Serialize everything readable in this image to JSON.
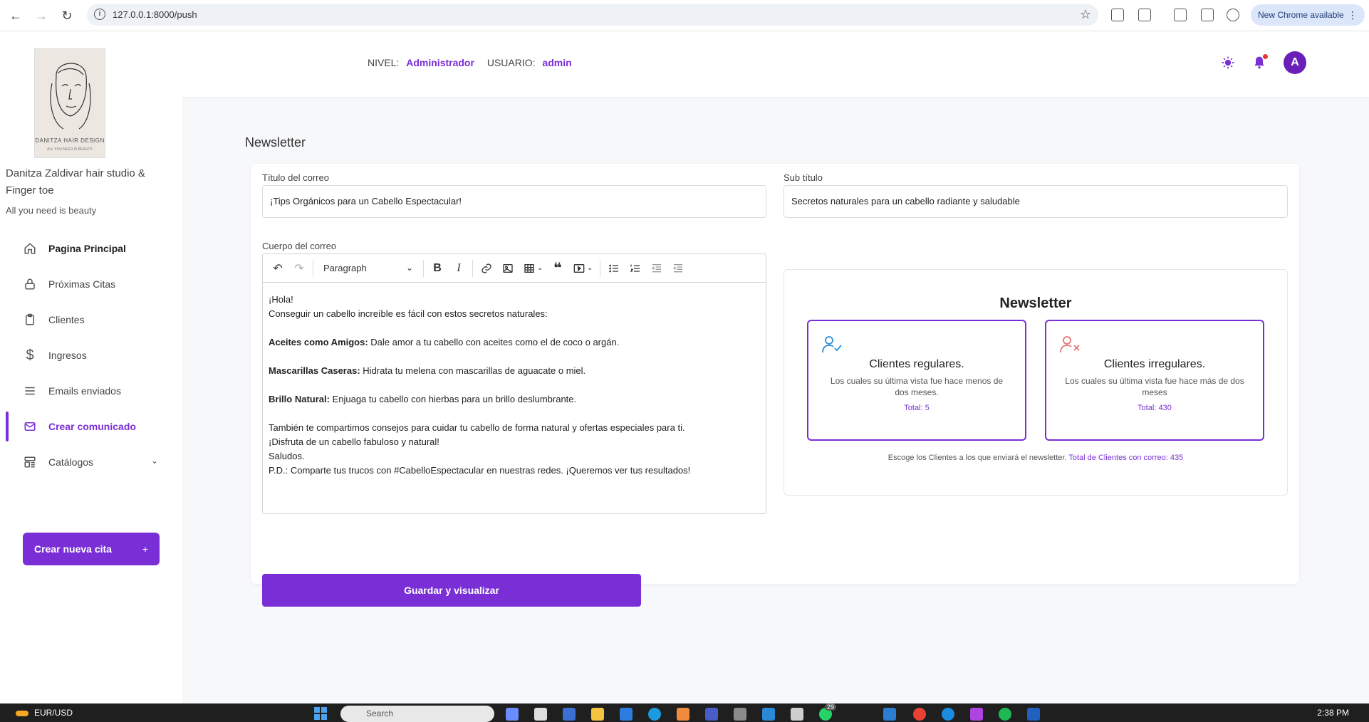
{
  "browser": {
    "url": "127.0.0.1:8000/push",
    "new_chrome_label": "New Chrome available"
  },
  "sidebar": {
    "logo_brand": "DANITZA HAIR DESIGN",
    "logo_tag": "ALL YOU NEED IS BEAUTY",
    "business_name": "Danitza Zaldivar hair studio & Finger toe",
    "slogan": "All you need is beauty",
    "items": [
      {
        "label": "Pagina Principal",
        "icon": "home-icon"
      },
      {
        "label": "Próximas Citas",
        "icon": "lock-icon"
      },
      {
        "label": "Clientes",
        "icon": "clipboard-icon"
      },
      {
        "label": "Ingresos",
        "icon": "dollar-icon"
      },
      {
        "label": "Emails enviados",
        "icon": "list-icon"
      },
      {
        "label": "Crear comunicado",
        "icon": "mail-icon"
      },
      {
        "label": "Catálogos",
        "icon": "catalog-icon"
      }
    ],
    "new_appointment_label": "Crear nueva cita",
    "new_appointment_plus": "+"
  },
  "header": {
    "level_label": "NIVEL:",
    "level_value": "Administrador",
    "user_label": "USUARIO:",
    "user_value": "admin",
    "avatar_letter": "A"
  },
  "page": {
    "title": "Newsletter"
  },
  "form": {
    "title_label": "Título del correo",
    "title_value": "¡Tips Orgánicos para un Cabello Espectacular!",
    "subtitle_label": "Sub título",
    "subtitle_value": "Secretos naturales para un cabello radiante y saludable",
    "body_label": "Cuerpo del correo",
    "paragraph_select": "Paragraph",
    "body": {
      "l1": "¡Hola!",
      "l2": "Conseguir un cabello increíble es fácil con estos secretos naturales:",
      "l3_bold": "Aceites como Amigos:",
      "l3_rest": " Dale amor a tu cabello con aceites como el de coco o argán.",
      "l4_bold": "Mascarillas Caseras:",
      "l4_rest": " Hidrata tu melena con mascarillas de aguacate o miel.",
      "l5_bold": "Brillo Natural:",
      "l5_rest": " Enjuaga tu cabello con hierbas para un brillo deslumbrante.",
      "l6": "También te compartimos consejos para cuidar tu cabello de forma natural y ofertas especiales para ti.",
      "l7": "¡Disfruta de un cabello fabuloso y natural!",
      "l8": "Saludos.",
      "l9": "P.D.: Comparte tus trucos con #CabelloEspectacular en nuestras redes. ¡Queremos ver tus resultados!"
    },
    "save_label": "Guardar y visualizar"
  },
  "newsletter_panel": {
    "title": "Newsletter",
    "regular": {
      "title": "Clientes regulares.",
      "desc": "Los cuales su última vista fue hace menos de dos meses.",
      "total": "Total: 5"
    },
    "irregular": {
      "title": "Clientes irregulares.",
      "desc": "Los cuales su última vista fue hace más de dos meses",
      "total": "Total: 430"
    },
    "note": "Escoge los Clientes a los que enviará el newsletter.",
    "note_total": "Total de Clientes con correo: 435"
  },
  "taskbar": {
    "ticker": "EUR/USD",
    "search_placeholder": "Search",
    "time": "2:38 PM",
    "badge": "29"
  },
  "colors": {
    "accent": "#7a2fd6",
    "regular_icon": "#2a8fd8",
    "irregular_icon": "#e57373"
  }
}
